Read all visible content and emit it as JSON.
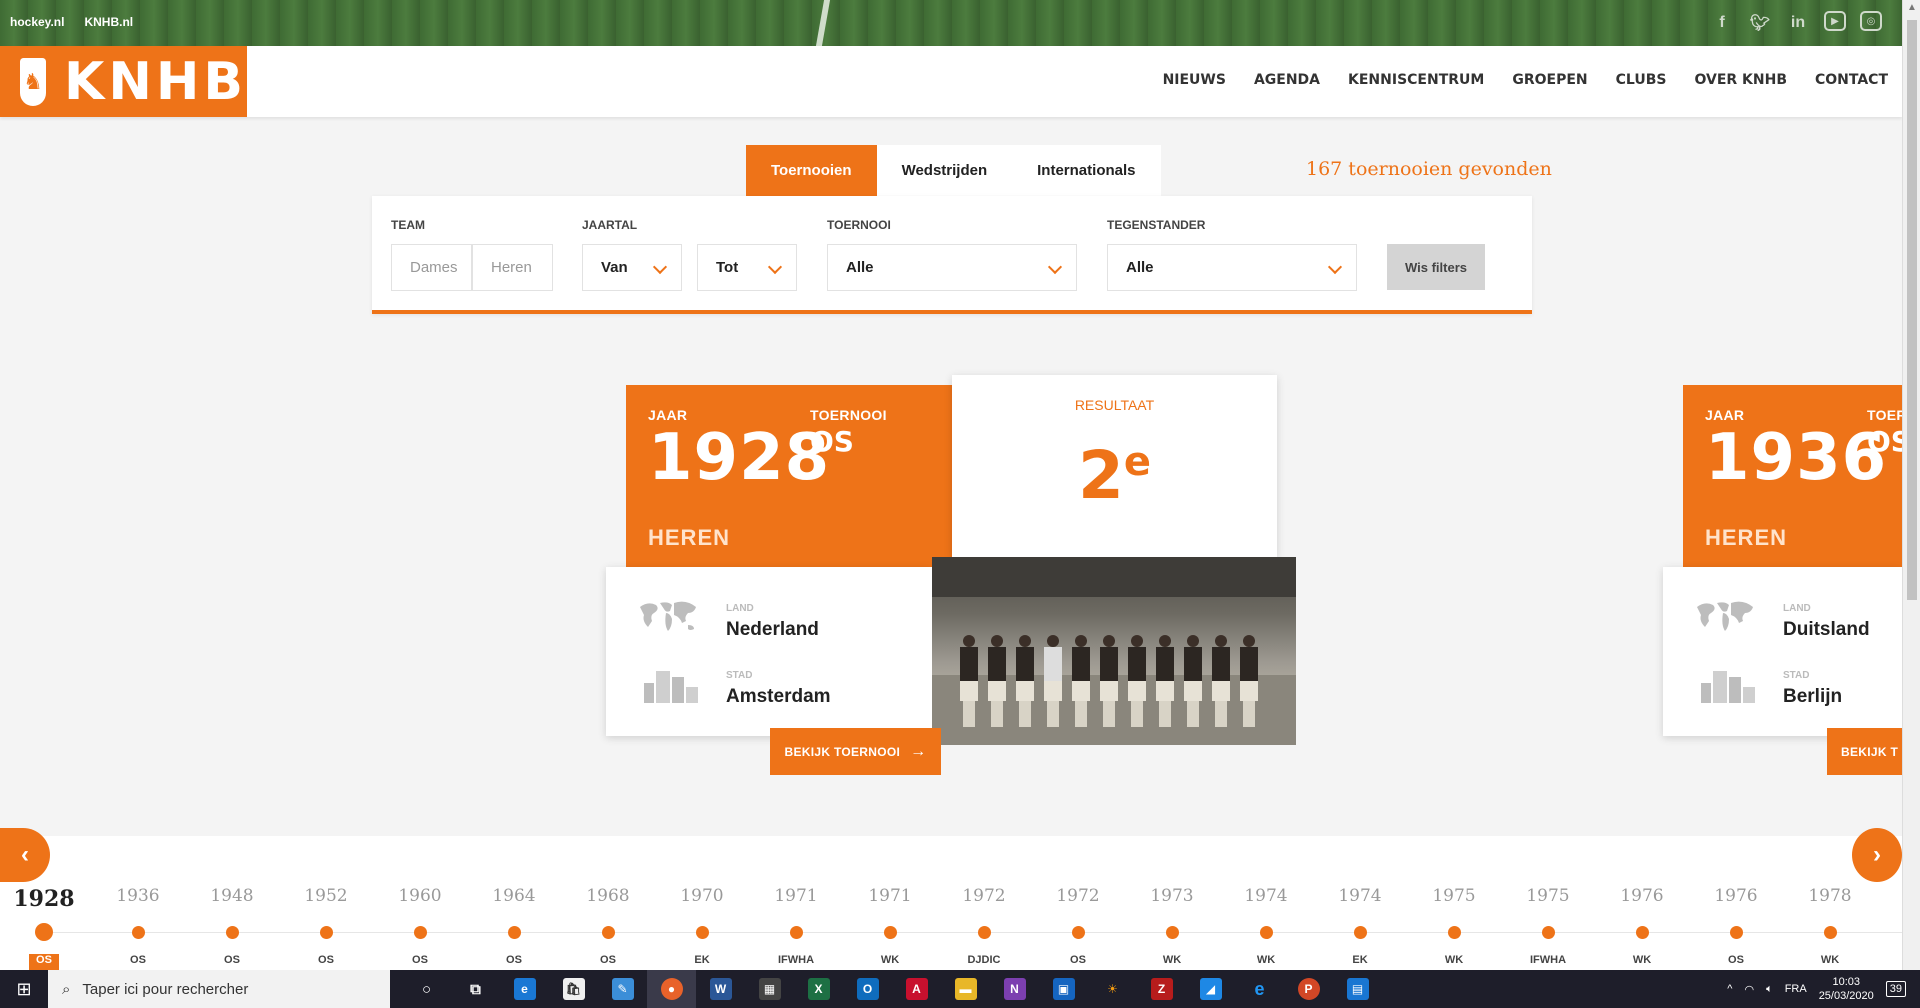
{
  "toplinks": [
    "hockey.nl",
    "KNHB.nl"
  ],
  "social_icons": [
    "facebook-icon",
    "twitter-icon",
    "linkedin-icon",
    "youtube-icon",
    "instagram-icon"
  ],
  "logo_text": "KNHB",
  "nav": [
    "NIEUWS",
    "AGENDA",
    "KENNISCENTRUM",
    "GROEPEN",
    "CLUBS",
    "OVER KNHB",
    "CONTACT"
  ],
  "tabs": [
    "Toernooien",
    "Wedstrijden",
    "Internationals"
  ],
  "result_count": "167 toernooien gevonden",
  "filters": {
    "team_label": "TEAM",
    "team_options": [
      "Dames",
      "Heren"
    ],
    "jaartal_label": "JAARTAL",
    "van": "Van",
    "tot": "Tot",
    "toernooi_label": "TOERNOOI",
    "toernooi_value": "Alle",
    "tegenstander_label": "TEGENSTANDER",
    "tegenstander_value": "Alle",
    "wis": "Wis filters"
  },
  "cards": [
    {
      "jaar_label": "JAAR",
      "toernooi_label": "TOERNOOI",
      "year": "1928",
      "tournament": "OS",
      "gender": "HEREN",
      "resultaat_label": "RESULTAAT",
      "resultaat": "2",
      "resultaat_sup": "e",
      "land_label": "LAND",
      "land": "Nederland",
      "stad_label": "STAD",
      "stad": "Amsterdam",
      "button": "BEKIJK TOERNOOI"
    },
    {
      "jaar_label": "JAAR",
      "toernooi_label": "TOER",
      "year": "1936",
      "tournament": "OS",
      "gender": "HEREN",
      "land_label": "LAND",
      "land": "Duitsland",
      "stad_label": "STAD",
      "stad": "Berlijn",
      "button": "BEKIJK T"
    }
  ],
  "timeline": [
    {
      "year": "1928",
      "code": "OS"
    },
    {
      "year": "1936",
      "code": "OS"
    },
    {
      "year": "1948",
      "code": "OS"
    },
    {
      "year": "1952",
      "code": "OS"
    },
    {
      "year": "1960",
      "code": "OS"
    },
    {
      "year": "1964",
      "code": "OS"
    },
    {
      "year": "1968",
      "code": "OS"
    },
    {
      "year": "1970",
      "code": "EK"
    },
    {
      "year": "1971",
      "code": "IFWHA"
    },
    {
      "year": "1971",
      "code": "WK"
    },
    {
      "year": "1972",
      "code": "DJDIC"
    },
    {
      "year": "1972",
      "code": "OS"
    },
    {
      "year": "1973",
      "code": "WK"
    },
    {
      "year": "1974",
      "code": "WK"
    },
    {
      "year": "1974",
      "code": "EK"
    },
    {
      "year": "1975",
      "code": "WK"
    },
    {
      "year": "1975",
      "code": "IFWHA"
    },
    {
      "year": "1976",
      "code": "WK"
    },
    {
      "year": "1976",
      "code": "OS"
    },
    {
      "year": "1978",
      "code": "WK"
    }
  ],
  "taskbar": {
    "search_placeholder": "Taper ici pour rechercher",
    "lang": "FRA",
    "time": "10:03",
    "date": "25/03/2020",
    "notifications": "39"
  },
  "colors": {
    "accent": "#ee7318",
    "grass": "#4c7c3e",
    "taskbar": "#1e1e2a"
  }
}
